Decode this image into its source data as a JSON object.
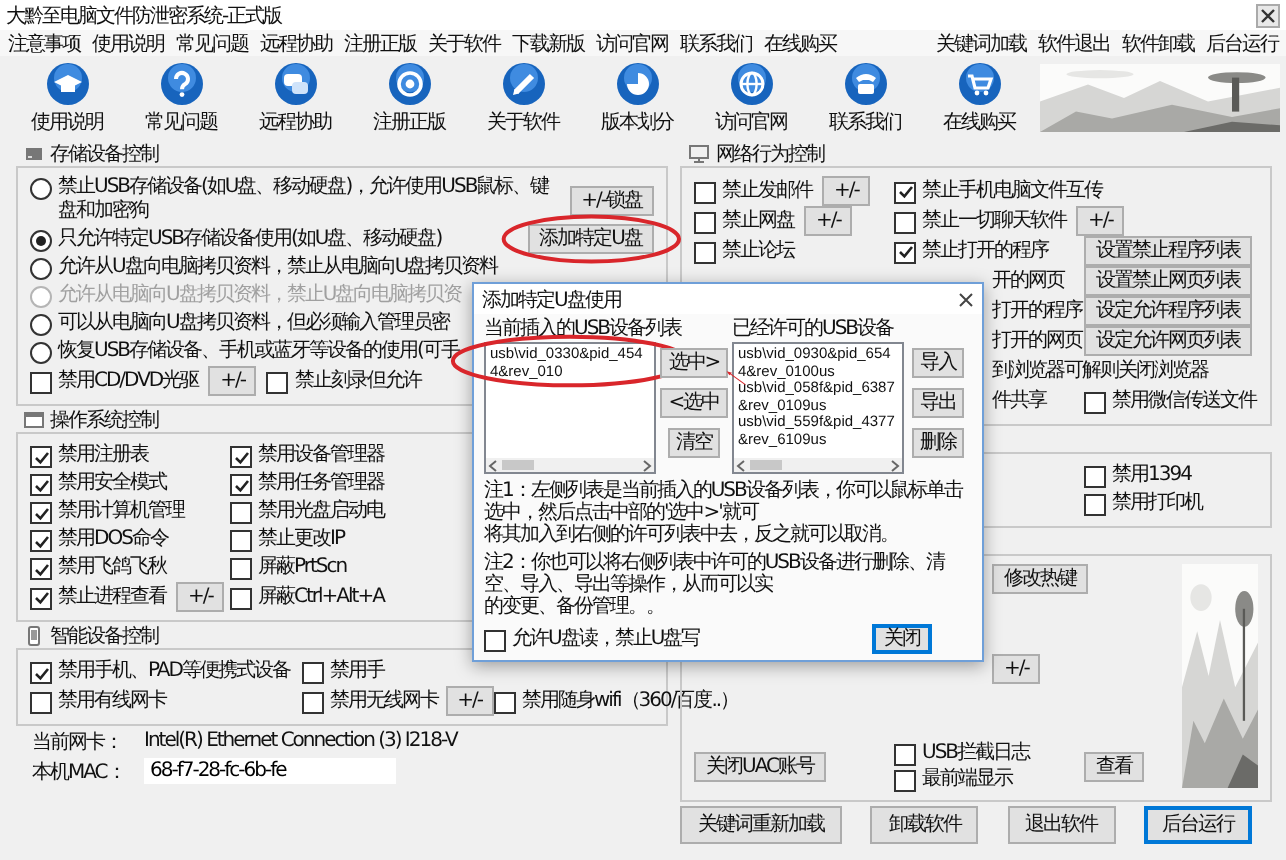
{
  "window": {
    "title": "大黔至电脑文件防泄密系统-正式版"
  },
  "menu": {
    "left": [
      "注意事项",
      "使用说明",
      "常见问题",
      "远程协助",
      "注册正版",
      "关于软件",
      "下载新版",
      "访问官网",
      "联系我们",
      "在线购买"
    ],
    "right": [
      "关键词加载",
      "软件退出",
      "软件卸载",
      "后台运行"
    ]
  },
  "toolbar": [
    {
      "label": "使用说明"
    },
    {
      "label": "常见问题"
    },
    {
      "label": "远程协助"
    },
    {
      "label": "注册正版"
    },
    {
      "label": "关于软件"
    },
    {
      "label": "版本划分"
    },
    {
      "label": "访问官网"
    },
    {
      "label": "联系我们"
    },
    {
      "label": "在线购买"
    }
  ],
  "banner": {
    "kind": "picture"
  },
  "left_groups": [
    {
      "title": "存储设备控制",
      "kind": "single",
      "rows": [
        {
          "column_1": [
            {
              "kind": "radio",
              "label": "禁止USB存储设备(如U盘、移动硬盘)，允许使用USB鼠标、键盘和加密狗",
              "selected": false,
              "disabled": false
            },
            {
              "kind": "button",
              "label": "+/-锁盘"
            }
          ]
        },
        {
          "column_1": [
            {
              "kind": "radio",
              "label": "只允许特定USB存储设备使用(如U盘、移动硬盘)",
              "selected": true,
              "disabled": false
            },
            {
              "kind": "button",
              "label": "添加特定U盘",
              "highlighted": true
            }
          ]
        },
        {
          "column_1": [
            {
              "kind": "radio",
              "label": "允许从U盘向电脑拷贝资料，禁止从电脑向U盘拷贝资料",
              "selected": false,
              "disabled": false
            }
          ]
        },
        {
          "column_1": [
            {
              "kind": "radio",
              "label": "允许从电脑向U盘拷贝资料，禁止U盘向电脑拷贝资",
              "selected": false,
              "disabled": true
            }
          ]
        },
        {
          "column_1": [
            {
              "kind": "radio",
              "label": "可以从电脑向U盘拷贝资料，但必须输入管理员密",
              "selected": false,
              "disabled": false
            }
          ]
        },
        {
          "column_1": [
            {
              "kind": "radio",
              "label": "恢复USB存储设备、手机或蓝牙等设备的使用(可手",
              "selected": false,
              "disabled": false
            }
          ]
        },
        {
          "column_1": [
            {
              "kind": "checkbox",
              "label": "禁用CD/DVD光驱",
              "checked": false
            },
            {
              "kind": "button",
              "label": "+/-"
            },
            {
              "kind": "checkbox",
              "label": "禁止刻录但允许",
              "checked": false
            }
          ]
        }
      ]
    },
    {
      "title": "操作系统控制",
      "kind": "os",
      "rows": [
        {
          "column_1": [
            {
              "kind": "checkbox",
              "label": "禁用注册表",
              "checked": true
            }
          ],
          "column_2": [
            {
              "kind": "checkbox",
              "label": "禁用设备管理器",
              "checked": true
            }
          ]
        },
        {
          "column_1": [
            {
              "kind": "checkbox",
              "label": "禁用安全模式",
              "checked": true
            }
          ],
          "column_2": [
            {
              "kind": "checkbox",
              "label": "禁用任务管理器",
              "checked": true
            }
          ]
        },
        {
          "column_1": [
            {
              "kind": "checkbox",
              "label": "禁用计算机管理",
              "checked": true
            }
          ],
          "column_2": [
            {
              "kind": "checkbox",
              "label": "禁用光盘启动电",
              "checked": false
            }
          ]
        },
        {
          "column_1": [
            {
              "kind": "checkbox",
              "label": "禁用DOS命令",
              "checked": true
            }
          ],
          "column_2": [
            {
              "kind": "checkbox",
              "label": "禁止更改IP",
              "checked": false
            }
          ]
        },
        {
          "column_1": [
            {
              "kind": "checkbox",
              "label": "禁用飞鸽飞秋",
              "checked": true
            }
          ],
          "column_2": [
            {
              "kind": "checkbox",
              "label": "屏蔽PrtScn",
              "checked": false
            }
          ]
        },
        {
          "column_1": [
            {
              "kind": "checkbox",
              "label": "禁止进程查看",
              "checked": true
            },
            {
              "kind": "button",
              "label": "+/-"
            }
          ],
          "column_2": [
            {
              "kind": "checkbox",
              "label": "屏蔽Ctrl+Alt+A",
              "checked": false
            }
          ]
        }
      ]
    },
    {
      "title": "智能设备控制",
      "kind": "smart",
      "rows": [
        {
          "column_1": [
            {
              "kind": "checkbox",
              "label": "禁用手机、PAD等便携式设备",
              "checked": true
            }
          ],
          "column_2": [
            {
              "kind": "checkbox",
              "label": "禁用手",
              "checked": false
            }
          ]
        },
        {
          "column_1": [
            {
              "kind": "checkbox",
              "label": "禁用有线网卡",
              "checked": false
            }
          ],
          "column_2": [
            {
              "kind": "checkbox",
              "label": "禁用无线网卡",
              "checked": false
            },
            {
              "kind": "button",
              "label": "+/-"
            }
          ],
          "column_3": [
            {
              "kind": "checkbox",
              "label": "禁用随身wifi（360/百度..）",
              "checked": false
            }
          ]
        }
      ]
    }
  ],
  "network_card": {
    "label": "当前网卡：",
    "value": "Intel(R) Ethernet Connection (3) I218-V"
  },
  "mac": {
    "label": "本机MAC：",
    "value": "68-f7-28-fc-6b-fe"
  },
  "right_groups": [
    {
      "title": "网络行为控制",
      "kind": "net",
      "rows": [
        {
          "column_1": [
            {
              "kind": "checkbox",
              "label": "禁止发邮件",
              "checked": false
            },
            {
              "kind": "button",
              "label": "+/-"
            }
          ],
          "column_2": [
            {
              "kind": "checkbox",
              "label": "禁止手机电脑文件互传",
              "checked": true
            }
          ]
        },
        {
          "column_1": [
            {
              "kind": "checkbox",
              "label": "禁止网盘",
              "checked": false
            },
            {
              "kind": "button",
              "label": "+/-"
            }
          ],
          "column_2": [
            {
              "kind": "checkbox",
              "label": "禁止一切聊天软件",
              "checked": false
            },
            {
              "kind": "button",
              "label": "+/-"
            }
          ]
        },
        {
          "column_1": [
            {
              "kind": "checkbox",
              "label": "禁止论坛",
              "checked": false
            }
          ],
          "column_2": [
            {
              "kind": "checkbox",
              "label": "禁止打开的程序",
              "checked": true
            }
          ],
          "column_3": [
            {
              "kind": "button",
              "label": "设置禁止程序列表"
            }
          ]
        },
        {
          "column_2": [
            {
              "kind": "text",
              "label": "开的网页"
            }
          ],
          "column_3": [
            {
              "kind": "button",
              "label": "设置禁止网页列表"
            }
          ]
        },
        {
          "column_2": [
            {
              "kind": "text",
              "label": "打开的程序"
            }
          ],
          "column_3": [
            {
              "kind": "button",
              "label": "设定允许程序列表"
            }
          ]
        },
        {
          "column_2": [
            {
              "kind": "text",
              "label": "打开的网页"
            }
          ],
          "column_3": [
            {
              "kind": "button",
              "label": "设定允许网页列表"
            }
          ]
        },
        {
          "column_2": [
            {
              "kind": "text",
              "label": "到浏览器可解则关闭浏览器"
            }
          ]
        },
        {
          "column_2": [
            {
              "kind": "text",
              "label": "件共享"
            }
          ],
          "column_3": [
            {
              "kind": "checkbox",
              "label": "禁用微信传送文件",
              "checked": false
            }
          ]
        }
      ]
    },
    {
      "kind": "dev",
      "rows": [
        {
          "column_3": [
            {
              "kind": "checkbox",
              "label": "禁用1394",
              "checked": false
            }
          ]
        },
        {
          "column_3": [
            {
              "kind": "checkbox",
              "label": "禁用打印机",
              "checked": false
            }
          ]
        }
      ]
    },
    {
      "kind": "misc",
      "side_picture": {
        "kind": "picture"
      },
      "rows": [
        {
          "column_2": [
            {
              "kind": "button",
              "label": "修改热键"
            }
          ]
        },
        {
          "column_2": [
            {
              "kind": "button",
              "label": "+/-"
            }
          ]
        },
        {
          "column_1": [
            {
              "kind": "button",
              "label": "关闭UAC账号"
            }
          ],
          "column_2": [
            {
              "kind": "checkbox",
              "label": "USB拦截日志",
              "checked": false
            },
            {
              "kind": "checkbox",
              "label": "最前端显示",
              "checked": false
            }
          ],
          "column_3": [
            {
              "kind": "button",
              "label": "查看"
            }
          ]
        }
      ]
    }
  ],
  "bottom_buttons": [
    {
      "label": "关键词重新加载",
      "focused": false
    },
    {
      "label": "卸载软件",
      "focused": false
    },
    {
      "label": "退出软件",
      "focused": false
    },
    {
      "label": "后台运行",
      "focused": true
    }
  ],
  "dialog": {
    "title": "添加特定U盘使用",
    "current_label": "当前插入的USB设备列表",
    "current_items": [
      {
        "text": "usb\\vid_0330&pid_4544&rev_010",
        "highlighted": true
      }
    ],
    "middle_buttons": [
      {
        "label": "选中>",
        "pointed": true
      },
      {
        "label": "<选中",
        "pointed": false
      },
      {
        "label": "清空",
        "pointed": false
      }
    ],
    "allowed_label": "已经许可的USB设备",
    "allowed_items": [
      "usb\\vid_0930&pid_6544&rev_0100us",
      "usb\\vid_058f&pid_6387&rev_0109us",
      "usb\\vid_559f&pid_4377&rev_6109us"
    ],
    "side_buttons": [
      "导入",
      "导出",
      "删除"
    ],
    "notes": [
      {
        "lines": [
          "注1：左侧列表是当前插入的USB设备列表，你可以鼠标单击选中，然后点击中部的'选中>'就可",
          "将其加入到右侧的许可列表中去，反之就可以取消。"
        ]
      },
      {
        "lines": [
          "注2：你也可以将右侧列表中许可的USB设备进行删除、清空、导入、导出等操作，从而可以实",
          "的变更、备份管理。。"
        ]
      }
    ],
    "read_only": {
      "label": "允许U盘读，禁止U盘写",
      "checked": false
    },
    "close_button": {
      "label": "关闭",
      "focused": true
    }
  }
}
